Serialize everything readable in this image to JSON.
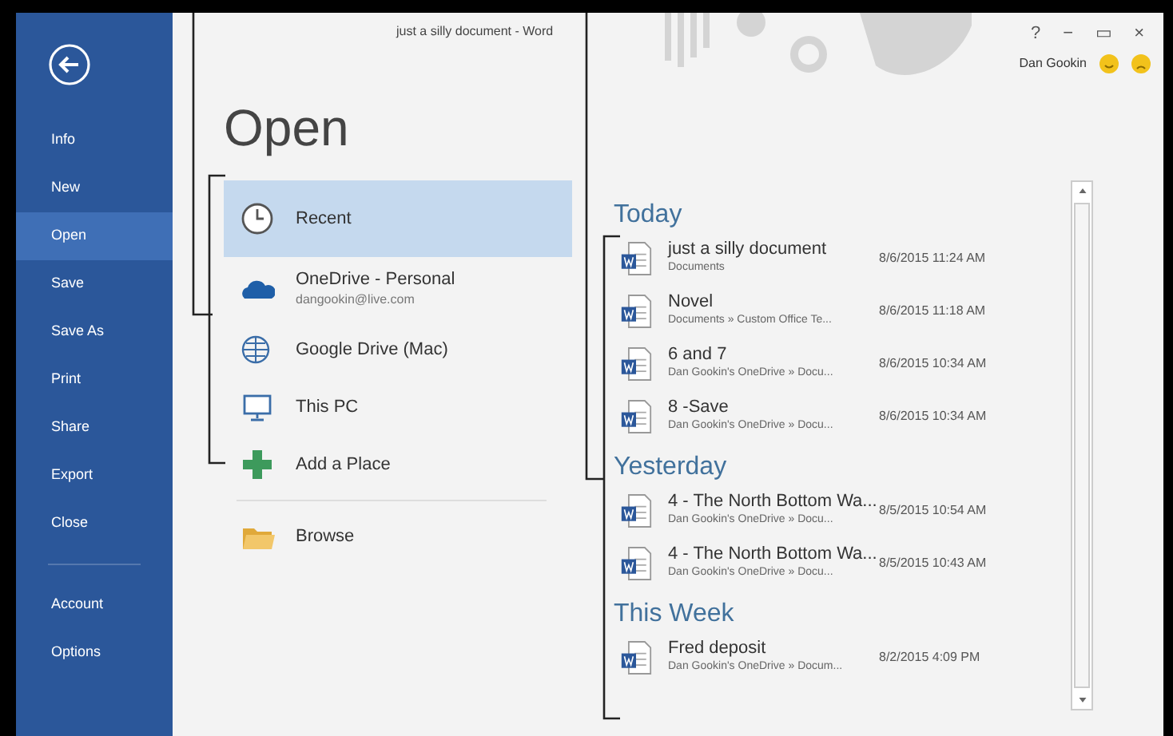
{
  "window": {
    "title": "just a silly document - Word",
    "controls": [
      "?",
      "−",
      "▭",
      "×"
    ],
    "user": "Dan Gookin"
  },
  "sidebar": {
    "items": [
      {
        "label": "Info",
        "selected": false
      },
      {
        "label": "New",
        "selected": false
      },
      {
        "label": "Open",
        "selected": true
      },
      {
        "label": "Save",
        "selected": false
      },
      {
        "label": "Save As",
        "selected": false
      },
      {
        "label": "Print",
        "selected": false
      },
      {
        "label": "Share",
        "selected": false
      },
      {
        "label": "Export",
        "selected": false
      },
      {
        "label": "Close",
        "selected": false
      }
    ],
    "footer_items": [
      {
        "label": "Account",
        "selected": false
      },
      {
        "label": "Options",
        "selected": false
      }
    ]
  },
  "heading": "Open",
  "places": [
    {
      "kind": "recent",
      "label": "Recent",
      "selected": true
    },
    {
      "kind": "onedrive",
      "label": "OneDrive - Personal",
      "sub": "dangookin@live.com",
      "selected": false
    },
    {
      "kind": "google_drive",
      "label": "Google Drive (Mac)",
      "selected": false
    },
    {
      "kind": "this_pc",
      "label": "This PC",
      "selected": false
    },
    {
      "kind": "add_place",
      "label": "Add a Place",
      "selected": false
    }
  ],
  "browse": {
    "kind": "browse",
    "label": "Browse"
  },
  "recent_groups": [
    {
      "heading": "Today",
      "files": [
        {
          "name": "just a silly document",
          "location": "Documents",
          "date": "8/6/2015 11:24 AM"
        },
        {
          "name": "Novel",
          "location": "Documents » Custom Office Te...",
          "date": "8/6/2015 11:18 AM"
        },
        {
          "name": "6 and 7",
          "location": "Dan Gookin's OneDrive » Docu...",
          "date": "8/6/2015 10:34 AM"
        },
        {
          "name": "8 -Save",
          "location": "Dan Gookin's OneDrive » Docu...",
          "date": "8/6/2015 10:34 AM"
        }
      ]
    },
    {
      "heading": "Yesterday",
      "files": [
        {
          "name": "4 - The North Bottom Wa...",
          "location": "Dan Gookin's OneDrive » Docu...",
          "date": "8/5/2015 10:54 AM"
        },
        {
          "name": "4 - The North Bottom Wa...",
          "location": "Dan Gookin's OneDrive » Docu...",
          "date": "8/5/2015 10:43 AM"
        }
      ]
    },
    {
      "heading": "This Week",
      "files": [
        {
          "name": "Fred deposit",
          "location": "Dan Gookin's OneDrive » Docum...",
          "date": "8/2/2015 4:09 PM"
        }
      ]
    }
  ]
}
